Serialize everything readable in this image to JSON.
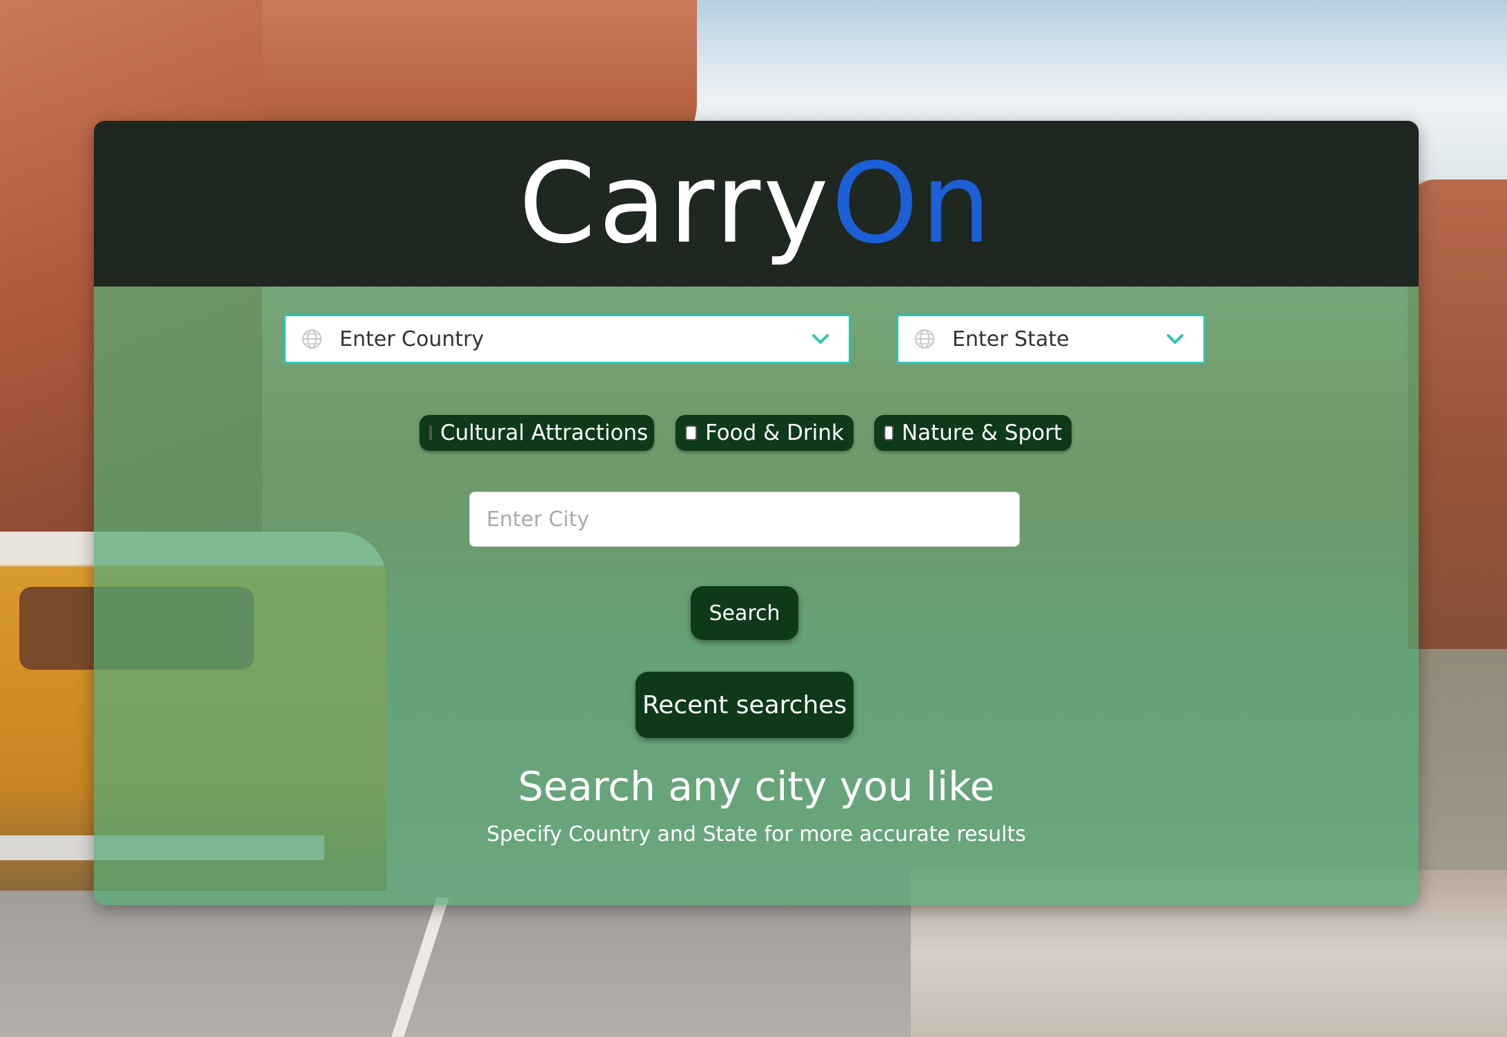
{
  "app": {
    "logo_part1": "Carry",
    "logo_part2": "On",
    "logo_accent_color": "#1c5fd6",
    "header_bg_color": "#1e2820"
  },
  "filters": {
    "country": {
      "label": "Enter Country",
      "icon": "globe-icon",
      "dropdown_icon": "chevron-down-icon"
    },
    "state": {
      "label": "Enter State",
      "icon": "globe-icon",
      "dropdown_icon": "chevron-down-icon"
    }
  },
  "categories": [
    {
      "label": "Cultural Attractions",
      "checked": false
    },
    {
      "label": "Food & Drink",
      "checked": false
    },
    {
      "label": "Nature & Sport",
      "checked": false
    }
  ],
  "city_input": {
    "placeholder": "Enter City",
    "value": ""
  },
  "buttons": {
    "search": "Search",
    "recent": "Recent searches",
    "bg_color": "#0f3a19"
  },
  "info": {
    "headline": "Search any city you like",
    "subline": "Specify Country and State for more accurate results"
  },
  "theme": {
    "panel_overlay_color": "#55aa76",
    "select_border_color": "#2ec4b0"
  }
}
